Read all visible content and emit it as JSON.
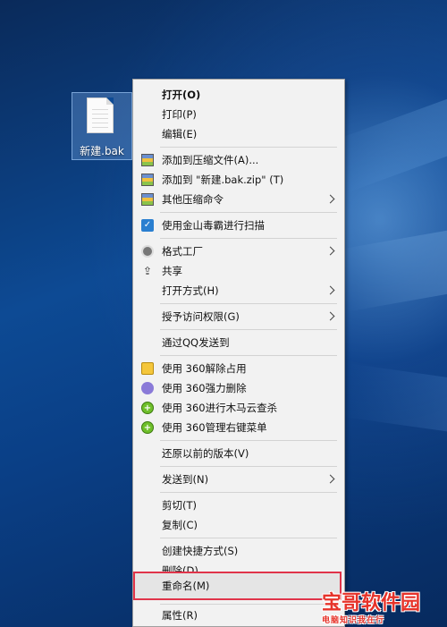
{
  "desktop": {
    "file_label": "新建.bak"
  },
  "context_menu": {
    "items": [
      {
        "label": "打开(O)"
      },
      {
        "label": "打印(P)"
      },
      {
        "label": "编辑(E)"
      },
      {
        "label": "添加到压缩文件(A)..."
      },
      {
        "label": "添加到 \"新建.bak.zip\" (T)"
      },
      {
        "label": "其他压缩命令"
      },
      {
        "label": "使用金山毒霸进行扫描"
      },
      {
        "label": "格式工厂"
      },
      {
        "label": "共享"
      },
      {
        "label": "打开方式(H)"
      },
      {
        "label": "授予访问权限(G)"
      },
      {
        "label": "通过QQ发送到"
      },
      {
        "label": "使用 360解除占用"
      },
      {
        "label": "使用 360强力删除"
      },
      {
        "label": "使用 360进行木马云查杀"
      },
      {
        "label": "使用 360管理右键菜单"
      },
      {
        "label": "还原以前的版本(V)"
      },
      {
        "label": "发送到(N)"
      },
      {
        "label": "剪切(T)"
      },
      {
        "label": "复制(C)"
      },
      {
        "label": "创建快捷方式(S)"
      },
      {
        "label": "删除(D)"
      },
      {
        "label": "重命名(M)"
      },
      {
        "label": "属性(R)"
      }
    ],
    "highlighted_item": "重命名(M)",
    "highlight_color": "#e0344a"
  },
  "watermark": {
    "title": "宝哥软件园",
    "subtitle": "电脑知识我在行"
  }
}
